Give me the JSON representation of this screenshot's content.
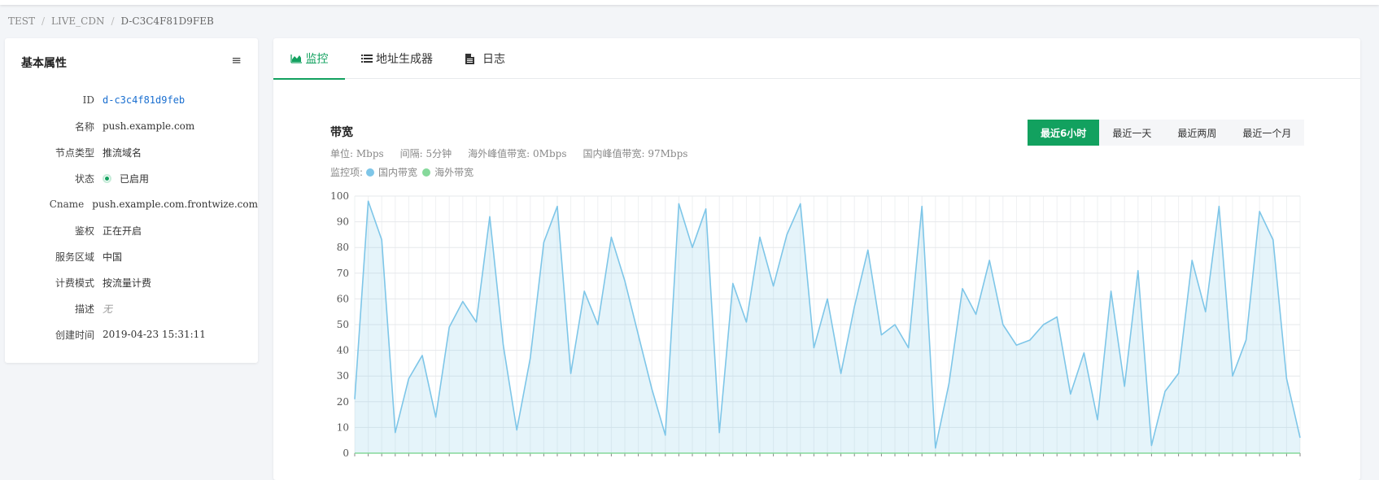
{
  "breadcrumb": [
    "TEST",
    "LIVE_CDN",
    "D-C3C4F81D9FEB"
  ],
  "left_panel": {
    "title": "基本属性",
    "menu_icon": "menu-icon",
    "props": [
      {
        "label": "ID",
        "value": "d-c3c4f81d9feb"
      },
      {
        "label": "名称",
        "value": "push.example.com"
      },
      {
        "label": "节点类型",
        "value": "推流域名"
      },
      {
        "label": "状态",
        "value": "已启用"
      },
      {
        "label": "Cname",
        "value": "push.example.com.frontwize.com"
      },
      {
        "label": "鉴权",
        "value": "正在开启"
      },
      {
        "label": "服务区域",
        "value": "中国"
      },
      {
        "label": "计费模式",
        "value": "按流量计费"
      },
      {
        "label": "描述",
        "value": "无"
      },
      {
        "label": "创建时间",
        "value": "2019-04-23 15:31:11"
      }
    ]
  },
  "tabs": [
    {
      "label": "监控",
      "icon": "area-chart-icon",
      "active": true
    },
    {
      "label": "地址生成器",
      "icon": "list-icon",
      "active": false
    },
    {
      "label": "日志",
      "icon": "file-icon",
      "active": false
    }
  ],
  "chart_panel": {
    "title": "带宽",
    "meta": [
      "单位: Mbps",
      "间隔: 5分钟",
      "海外峰值带宽: 0Mbps",
      "国内峰值带宽: 97Mbps"
    ],
    "legend_prefix": "监控项:",
    "range_buttons": [
      {
        "label": "最近6小时",
        "active": true
      },
      {
        "label": "最近一天",
        "active": false
      },
      {
        "label": "最近两周",
        "active": false
      },
      {
        "label": "最近一个月",
        "active": false
      }
    ]
  },
  "colors": {
    "accent": "#12a15f",
    "domestic": "#7ec6e8",
    "overseas": "#86d99b"
  },
  "chart_data": {
    "type": "area",
    "title": "",
    "xlabel": "",
    "ylabel": "",
    "ylim": [
      0,
      100
    ],
    "yticks": [
      0,
      10,
      20,
      30,
      40,
      50,
      60,
      70,
      80,
      90,
      100
    ],
    "grid": true,
    "series": [
      {
        "name": "国内带宽",
        "color": "#7ec6e8",
        "values": [
          21,
          98,
          83,
          8,
          29,
          38,
          14,
          49,
          59,
          51,
          92,
          42,
          9,
          37,
          82,
          96,
          31,
          63,
          50,
          84,
          67,
          46,
          25,
          7,
          97,
          80,
          95,
          8,
          66,
          51,
          84,
          65,
          85,
          97,
          41,
          60,
          31,
          57,
          79,
          46,
          50,
          41,
          96,
          2,
          27,
          64,
          54,
          75,
          50,
          42,
          44,
          50,
          53,
          23,
          39,
          13,
          63,
          26,
          71,
          3,
          24,
          31,
          75,
          55,
          96,
          30,
          44,
          94,
          83,
          29,
          6
        ]
      },
      {
        "name": "海外带宽",
        "color": "#86d99b",
        "values": [
          0,
          0,
          0,
          0,
          0,
          0,
          0,
          0,
          0,
          0,
          0,
          0,
          0,
          0,
          0,
          0,
          0,
          0,
          0,
          0,
          0,
          0,
          0,
          0,
          0,
          0,
          0,
          0,
          0,
          0,
          0,
          0,
          0,
          0,
          0,
          0,
          0,
          0,
          0,
          0,
          0,
          0,
          0,
          0,
          0,
          0,
          0,
          0,
          0,
          0,
          0,
          0,
          0,
          0,
          0,
          0,
          0,
          0,
          0,
          0,
          0,
          0,
          0,
          0,
          0,
          0,
          0,
          0,
          0,
          0,
          0
        ]
      }
    ]
  }
}
